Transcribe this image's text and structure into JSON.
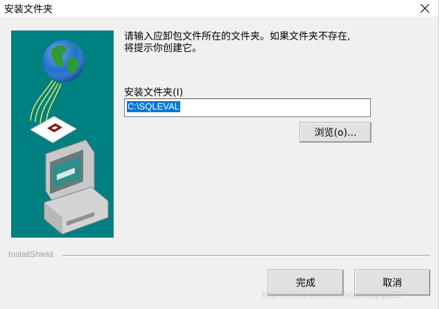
{
  "window": {
    "title": "安装文件夹",
    "close_glyph": "✕"
  },
  "content": {
    "instruction_line1": "请输入应卸包文件所在的文件夹。如果文件夹不存在,",
    "instruction_line2": "将提示你创建它。",
    "folder_label": "安装文件夹(I)",
    "folder_value": "C:\\SQLEVAL"
  },
  "buttons": {
    "browse": "浏览(o)...",
    "finish": "完成",
    "cancel": "取消"
  },
  "footer": {
    "brand": "InstallShield"
  },
  "watermark": "https://blog.csdn.net/xiaoliqiqiqiq20",
  "colors": {
    "artwork_bg": "#008080",
    "selection": "#0078d7",
    "dialog_bg": "#f0f0f0"
  }
}
